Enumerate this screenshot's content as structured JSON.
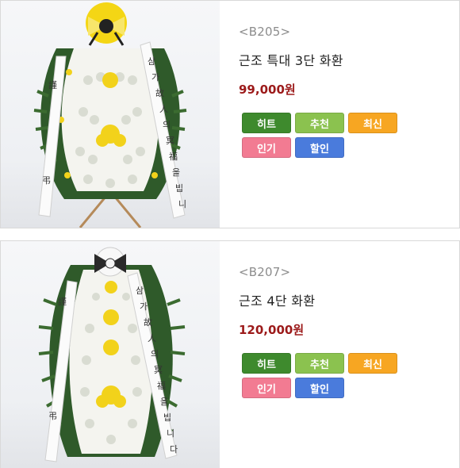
{
  "products": [
    {
      "code": "<B205>",
      "name": "근조 특대 3단 화환",
      "price": "99,000원",
      "image_alt": "funeral-wreath",
      "badges": {
        "hit": "히트",
        "recommend": "추천",
        "new": "최신",
        "popular": "인기",
        "sale": "할인"
      }
    },
    {
      "code": "<B207>",
      "name": "근조 4단 화환",
      "price": "120,000원",
      "image_alt": "funeral-wreath",
      "badges": {
        "hit": "히트",
        "recommend": "추천",
        "new": "최신",
        "popular": "인기",
        "sale": "할인"
      }
    }
  ],
  "colors": {
    "hit": "#3e8a2d",
    "recommend": "#8bc24f",
    "new": "#f7a622",
    "popular": "#f27b92",
    "sale": "#4a7bdc",
    "price": "#9c1a1a"
  }
}
